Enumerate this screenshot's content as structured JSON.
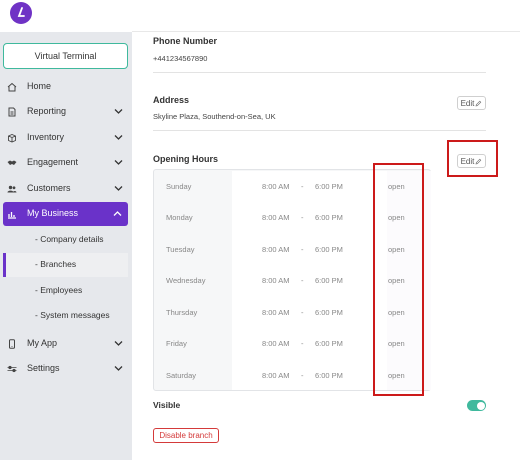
{
  "sidebar": {
    "virtual_terminal_label": "Virtual Terminal",
    "items": [
      {
        "label": "Home",
        "icon": "home-icon"
      },
      {
        "label": "Reporting",
        "icon": "report-icon"
      },
      {
        "label": "Inventory",
        "icon": "box-icon"
      },
      {
        "label": "Engagement",
        "icon": "handshake-icon"
      },
      {
        "label": "Customers",
        "icon": "users-icon"
      },
      {
        "label": "My Business",
        "icon": "chart-icon",
        "active": true
      },
      {
        "label": "My App",
        "icon": "phone-icon"
      },
      {
        "label": "Settings",
        "icon": "sliders-icon"
      }
    ],
    "sub_items": [
      {
        "label": "- Company details"
      },
      {
        "label": "- Branches",
        "selected": true
      },
      {
        "label": "- Employees"
      },
      {
        "label": "- System messages"
      }
    ]
  },
  "phone": {
    "title": "Phone Number",
    "value": "+441234567890"
  },
  "address": {
    "title": "Address",
    "value": "Skyline Plaza, Southend-on-Sea, UK",
    "edit_label": "Edit"
  },
  "opening_hours": {
    "title": "Opening Hours",
    "edit_label": "Edit",
    "rows": [
      {
        "day": "Sunday",
        "start": "8:00 AM",
        "sep": "-",
        "end": "6:00 PM",
        "status": "open"
      },
      {
        "day": "Monday",
        "start": "8:00 AM",
        "sep": "-",
        "end": "6:00 PM",
        "status": "open"
      },
      {
        "day": "Tuesday",
        "start": "8:00 AM",
        "sep": "-",
        "end": "6:00 PM",
        "status": "open"
      },
      {
        "day": "Wednesday",
        "start": "8:00 AM",
        "sep": "-",
        "end": "6:00 PM",
        "status": "open"
      },
      {
        "day": "Thursday",
        "start": "8:00 AM",
        "sep": "-",
        "end": "6:00 PM",
        "status": "open"
      },
      {
        "day": "Friday",
        "start": "8:00 AM",
        "sep": "-",
        "end": "6:00 PM",
        "status": "open"
      },
      {
        "day": "Saturday",
        "start": "8:00 AM",
        "sep": "-",
        "end": "6:00 PM",
        "status": "open"
      }
    ]
  },
  "visible": {
    "label": "Visible",
    "on": true
  },
  "disable_branch_label": "Disable branch",
  "colors": {
    "accent": "#6a32c9",
    "teal": "#3fb99d",
    "danger": "#d43a3a",
    "highlight": "#cc1a1a"
  }
}
